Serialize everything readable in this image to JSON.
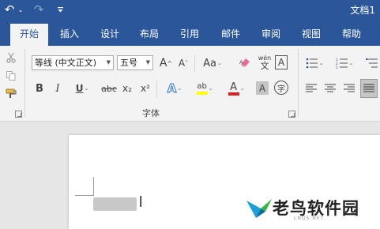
{
  "titlebar": {
    "undo_icon": "↶",
    "undo_dropdown": "⌄",
    "redo_icon": "↷",
    "customize_icon": "⩡",
    "doc_title": "文档1"
  },
  "tabs": [
    {
      "label": "开始",
      "active": true
    },
    {
      "label": "插入",
      "active": false
    },
    {
      "label": "设计",
      "active": false
    },
    {
      "label": "布局",
      "active": false
    },
    {
      "label": "引用",
      "active": false
    },
    {
      "label": "邮件",
      "active": false
    },
    {
      "label": "审阅",
      "active": false
    },
    {
      "label": "视图",
      "active": false
    },
    {
      "label": "帮助",
      "active": false
    }
  ],
  "font": {
    "name": "等线 (中文正文)",
    "size": "五号",
    "group_label": "字体",
    "grow": "A",
    "shrink": "A",
    "case": "Aa",
    "phonetic_top": "wén",
    "phonetic_bottom": "文",
    "border_char": "A",
    "bold": "B",
    "italic": "I",
    "underline": "U",
    "strike": "abc",
    "subscript": "x₂",
    "superscript": "x²",
    "effects": "A",
    "highlight": "ab",
    "font_color": "A",
    "shading": "A",
    "enclose": "字"
  },
  "colors": {
    "brand": "#2b579a",
    "highlight": "#ffff00",
    "font_color": "#e02020"
  },
  "watermark": {
    "text": "老鸟软件园",
    "sub": "LNQS.NET"
  }
}
